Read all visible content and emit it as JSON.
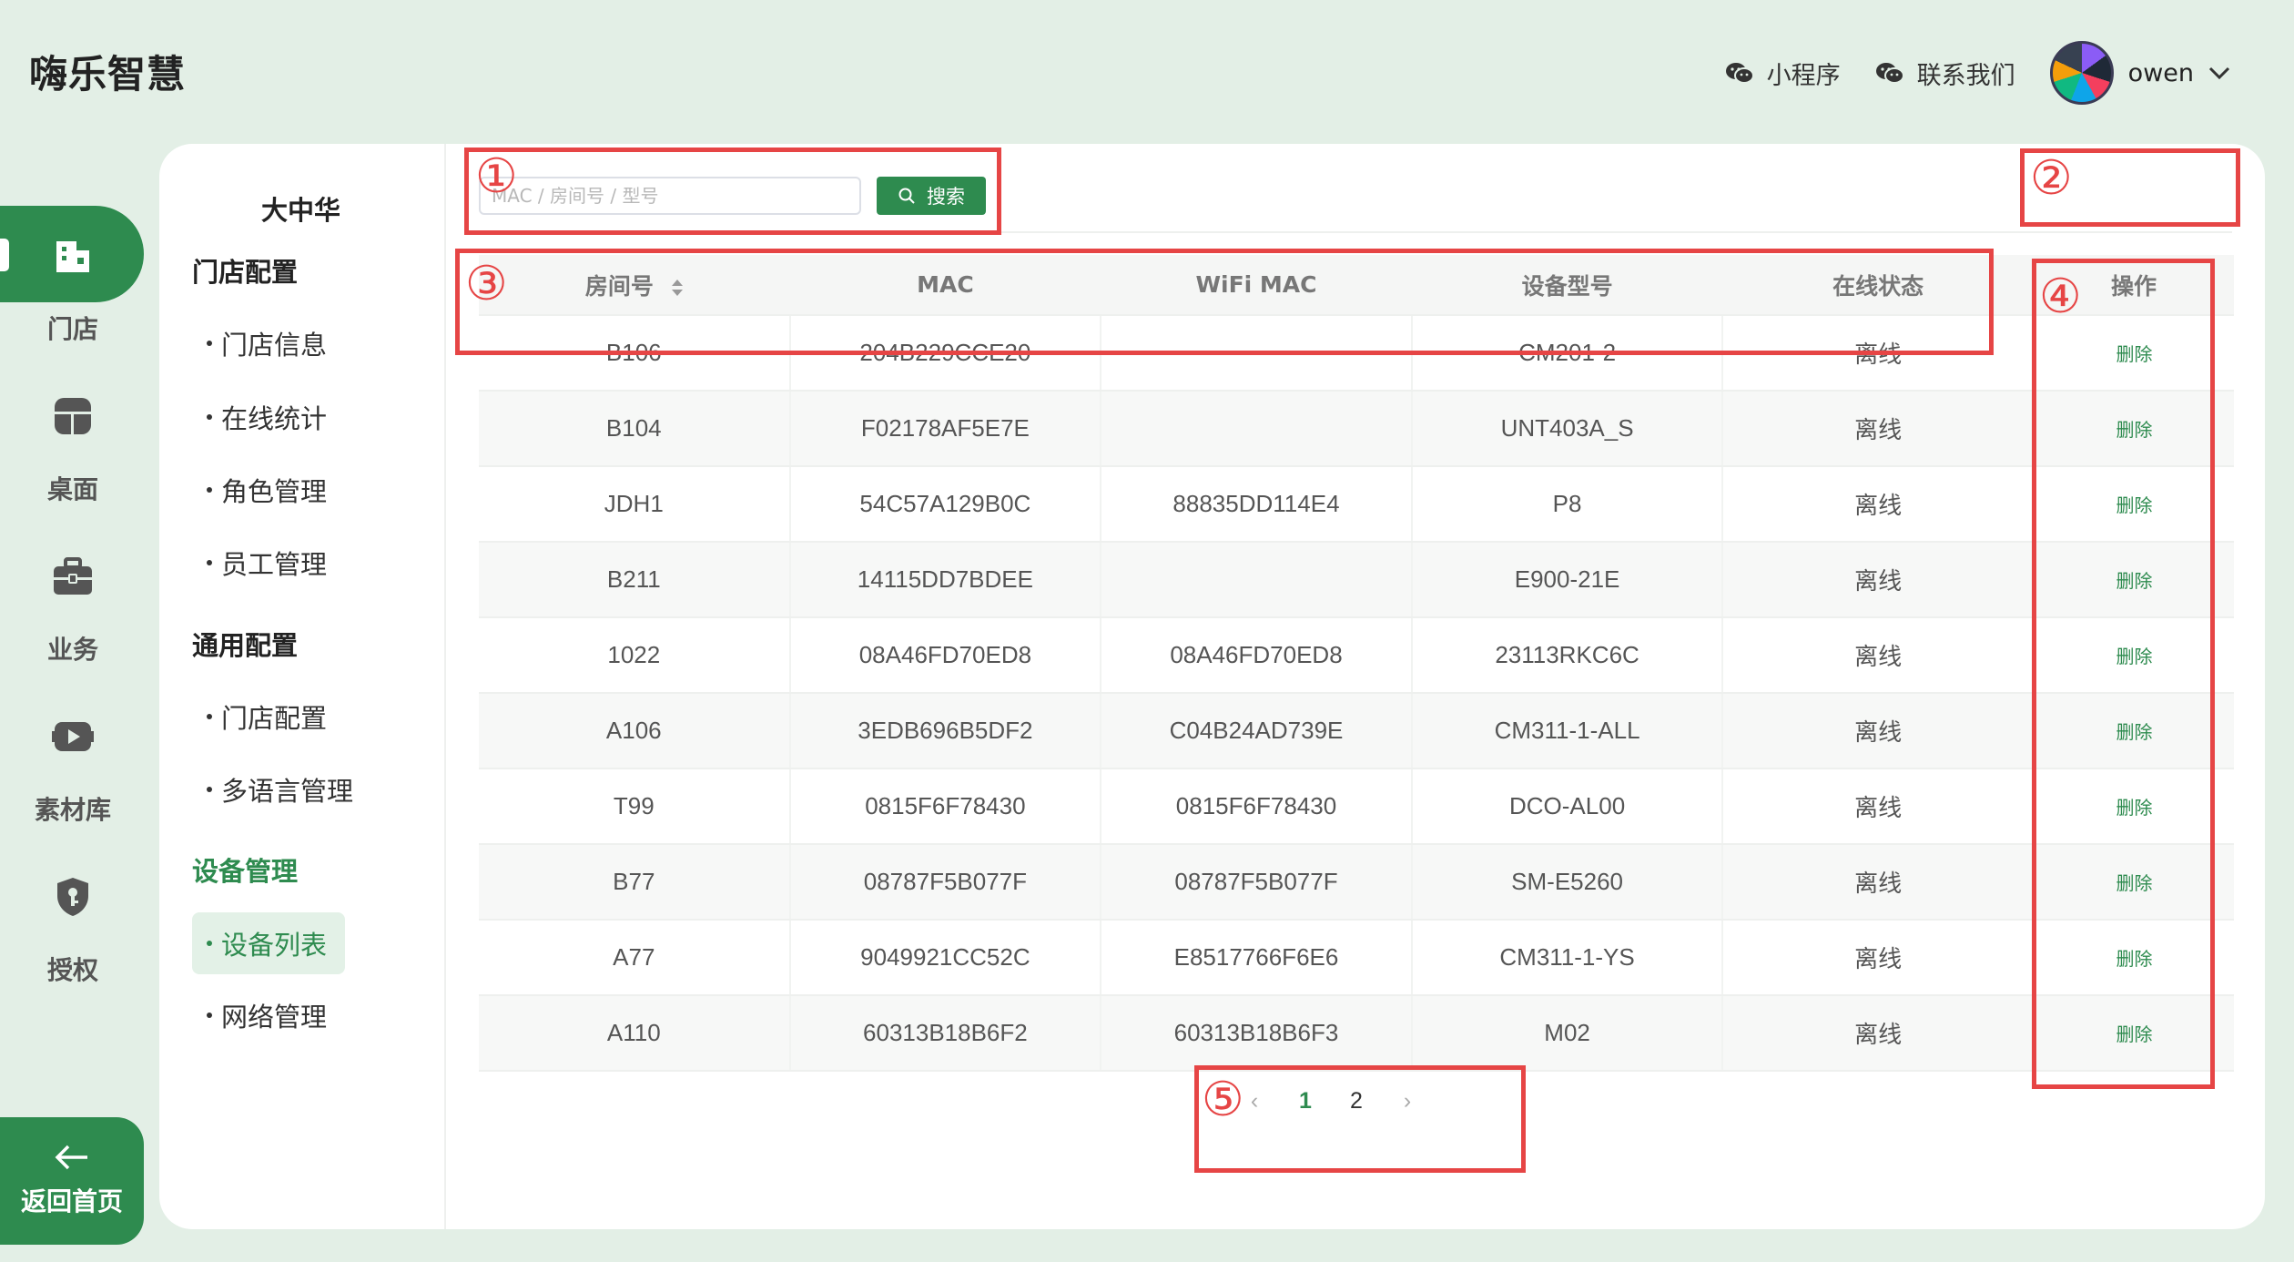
{
  "header": {
    "brand": "嗨乐智慧",
    "miniprogram_label": "小程序",
    "contact_label": "联系我们",
    "username": "owen"
  },
  "rail": {
    "items": [
      {
        "label": "门店",
        "icon": "store-icon",
        "active": true
      },
      {
        "label": "桌面",
        "icon": "desktop-icon",
        "active": false
      },
      {
        "label": "业务",
        "icon": "briefcase-icon",
        "active": false
      },
      {
        "label": "素材库",
        "icon": "media-library-icon",
        "active": false
      },
      {
        "label": "授权",
        "icon": "shield-key-icon",
        "active": false
      }
    ],
    "back_label": "返回首页"
  },
  "submenu": {
    "store_name": "大中华",
    "groups": [
      {
        "title": "门店配置",
        "items": [
          "门店信息",
          "在线统计",
          "角色管理",
          "员工管理"
        ]
      },
      {
        "title": "通用配置",
        "items": [
          "门店配置",
          "多语言管理"
        ]
      },
      {
        "title": "设备管理",
        "items": [
          "设备列表",
          "网络管理"
        ],
        "active_item": "设备列表"
      }
    ]
  },
  "search": {
    "placeholder": "MAC / 房间号 / 型号",
    "value": "",
    "button_label": "搜索"
  },
  "table": {
    "columns": [
      "房间号",
      "MAC",
      "WiFi MAC",
      "设备型号",
      "在线状态",
      "操作"
    ],
    "delete_label": "删除",
    "rows": [
      [
        "B106",
        "204B229CCE20",
        "",
        "CM201-2",
        "离线"
      ],
      [
        "B104",
        "F02178AF5E7E",
        "",
        "UNT403A_S",
        "离线"
      ],
      [
        "JDH1",
        "54C57A129B0C",
        "88835DD114E4",
        "P8",
        "离线"
      ],
      [
        "B211",
        "14115DD7BDEE",
        "",
        "E900-21E",
        "离线"
      ],
      [
        "1022",
        "08A46FD70ED8",
        "08A46FD70ED8",
        "23113RKC6C",
        "离线"
      ],
      [
        "A106",
        "3EDB696B5DF2",
        "C04B24AD739E",
        "CM311-1-ALL",
        "离线"
      ],
      [
        "T99",
        "0815F6F78430",
        "0815F6F78430",
        "DCO-AL00",
        "离线"
      ],
      [
        "B77",
        "08787F5B077F",
        "08787F5B077F",
        "SM-E5260",
        "离线"
      ],
      [
        "A77",
        "9049921CC52C",
        "E8517766F6E6",
        "CM311-1-YS",
        "离线"
      ],
      [
        "A110",
        "60313B18B6F2",
        "60313B18B6F3",
        "M02",
        "离线"
      ]
    ]
  },
  "pagination": {
    "prev": "‹",
    "pages": [
      "1",
      "2"
    ],
    "current": "1",
    "next": "›"
  },
  "annotations": [
    "①",
    "②",
    "③",
    "④",
    "⑤"
  ],
  "colors": {
    "accent": "#2e8b4f",
    "background": "#e3efe6",
    "annotation": "#e64545"
  }
}
